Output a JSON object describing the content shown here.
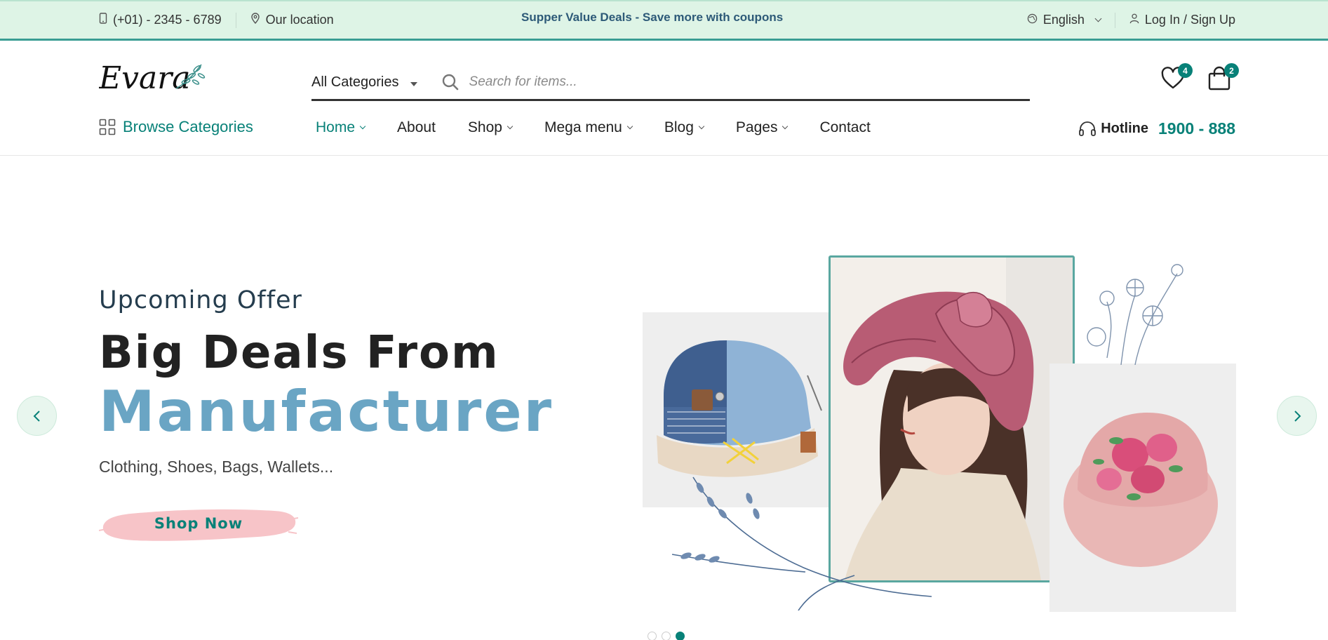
{
  "topbar": {
    "phone": "(+01) - 2345 - 6789",
    "location": "Our location",
    "promo": "Supper Value Deals - Save more with coupons",
    "language": "English",
    "login": "Log In / Sign Up"
  },
  "header": {
    "logo_text": "Evara",
    "category_select": "All Categories",
    "search_placeholder": "Search for items...",
    "wishlist_count": "4",
    "cart_count": "2"
  },
  "nav": {
    "browse": "Browse Categories",
    "items": [
      {
        "label": "Home",
        "dropdown": true,
        "active": true
      },
      {
        "label": "About",
        "dropdown": false
      },
      {
        "label": "Shop",
        "dropdown": true
      },
      {
        "label": "Mega menu",
        "dropdown": true
      },
      {
        "label": "Blog",
        "dropdown": true
      },
      {
        "label": "Pages",
        "dropdown": true
      },
      {
        "label": "Contact",
        "dropdown": false
      }
    ],
    "hotline_label": "Hotline",
    "hotline_number": "1900 - 888"
  },
  "hero": {
    "subtitle": "Upcoming Offer",
    "title": "Big Deals From",
    "title_highlight": "Manufacturer",
    "description": "Clothing, Shoes, Bags, Wallets...",
    "button": "Shop Now",
    "slides_total": 3,
    "active_slide": 3
  },
  "colors": {
    "brand": "#088178",
    "topbar_bg": "#def4e6",
    "highlight_blue": "#6aa5c4",
    "button_pink": "#f7c4c8"
  }
}
